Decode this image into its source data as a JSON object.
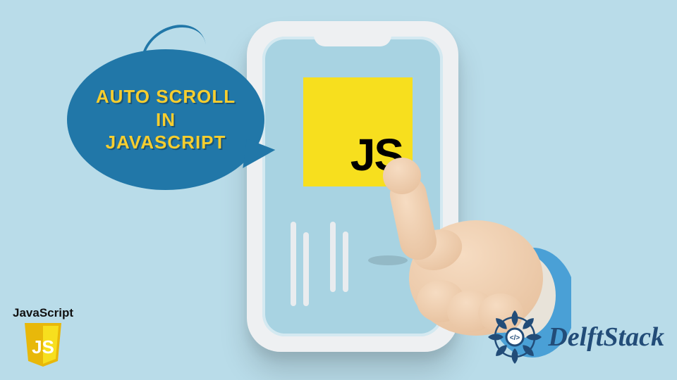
{
  "colors": {
    "background": "#b9dce9",
    "bubble": "#2177a8",
    "bubble_text": "#f6ce2f",
    "js_yellow": "#f7df1e",
    "delftstack": "#224c78"
  },
  "bubble": {
    "line1": "AUTO SCROLL",
    "line2": "IN",
    "line3": "JAVASCRIPT"
  },
  "js_logo_text": "JS",
  "badge": {
    "label": "JavaScript",
    "shield_text": "JS"
  },
  "brand": {
    "name": "DelftStack",
    "icon_inner": "</>"
  }
}
